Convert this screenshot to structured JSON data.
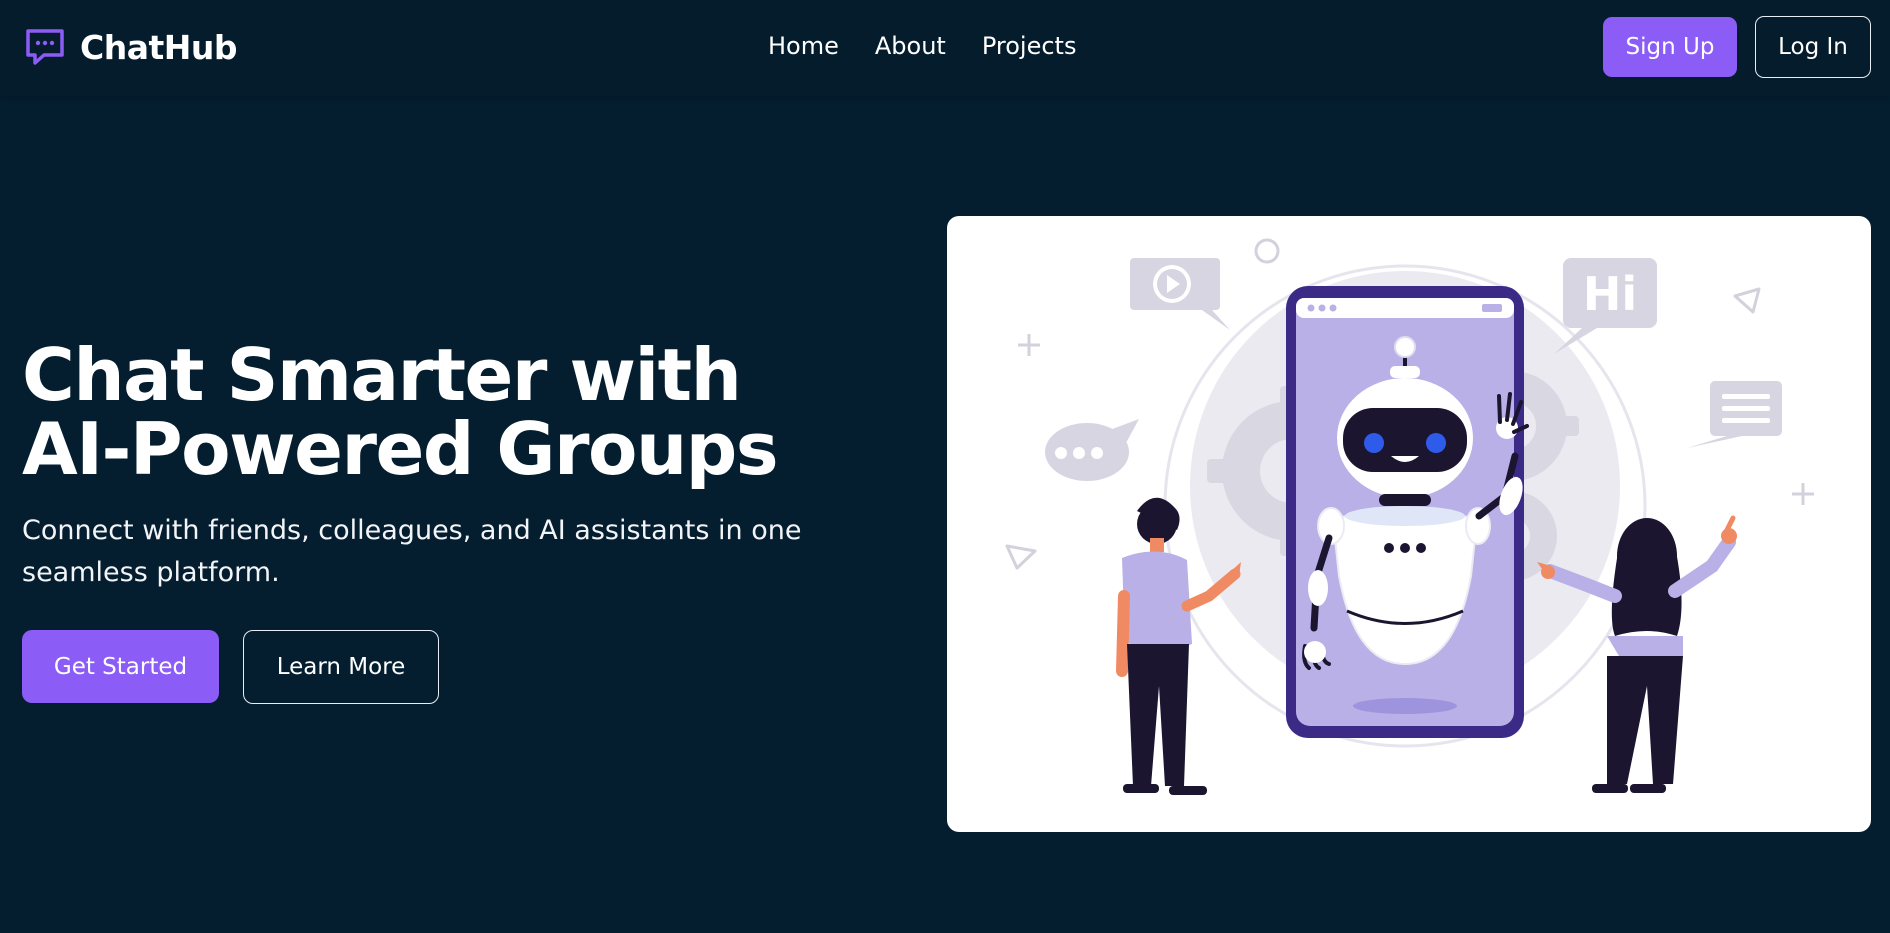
{
  "brand": {
    "name": "ChatHub",
    "color": "#8b5cf6"
  },
  "nav": {
    "links": [
      "Home",
      "About",
      "Projects"
    ]
  },
  "auth": {
    "signup_label": "Sign Up",
    "login_label": "Log In"
  },
  "hero": {
    "title": "Chat Smarter with AI-Powered Groups",
    "subtitle": "Connect with friends, colleagues, and AI assistants in one seamless platform.",
    "primary_cta": "Get Started",
    "secondary_cta": "Learn More"
  },
  "illustration": {
    "hi_bubble_text": "Hi"
  },
  "colors": {
    "background": "#041e30",
    "accent": "#8b5cf6",
    "card": "#ffffff",
    "illustration_lavender": "#b9b1e7",
    "illustration_navy": "#1b1530"
  }
}
